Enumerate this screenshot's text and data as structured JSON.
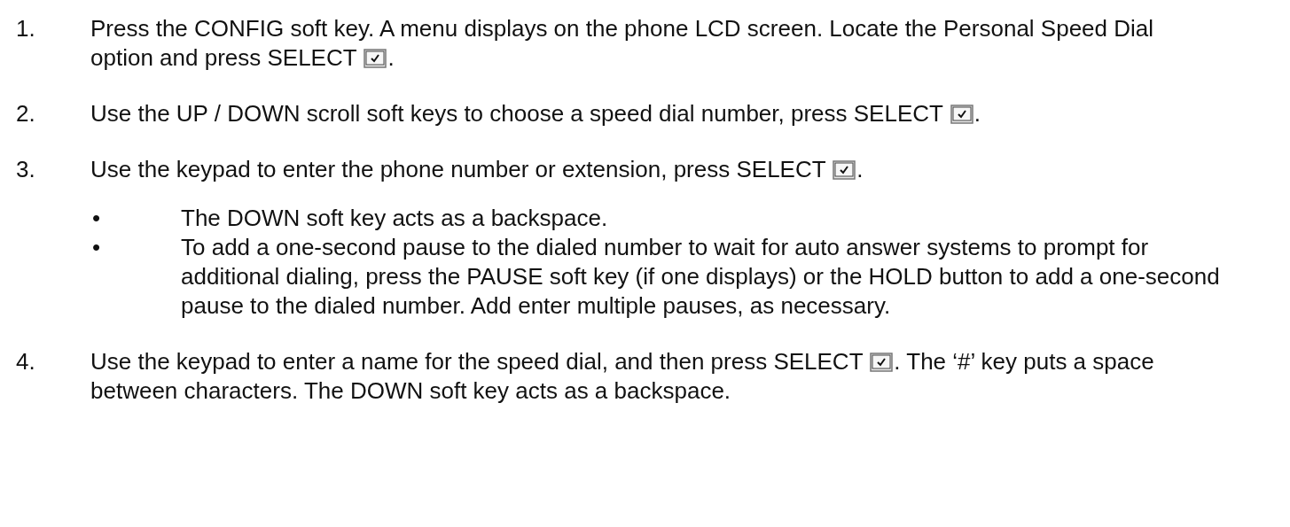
{
  "steps": [
    {
      "number": "1.",
      "text_before": "Press the CONFIG soft key. A menu displays on the phone LCD screen. Locate the Personal Speed Dial option and press SELECT ",
      "text_after": "."
    },
    {
      "number": "2.",
      "text_before": "Use the UP / DOWN scroll soft keys to choose a speed dial number, press SELECT ",
      "text_after": "."
    },
    {
      "number": "3.",
      "text_before": "Use the keypad to enter the phone number or extension, press SELECT ",
      "text_after": ".",
      "bullets": [
        {
          "marker": "•",
          "text": "The DOWN soft key acts as a backspace."
        },
        {
          "marker": "•",
          "text": "To add a one-second pause to the dialed number to wait for auto answer systems to prompt for additional dialing, press the PAUSE soft key (if one displays) or the HOLD button to add a one-second pause to the dialed number. Add enter multiple pauses, as necessary."
        }
      ]
    },
    {
      "number": "4.",
      "text_before": "Use the keypad to enter a name for the speed dial, and then press SELECT ",
      "text_after": ". The ‘#’ key puts a space between characters. The DOWN soft key acts as a backspace."
    }
  ]
}
